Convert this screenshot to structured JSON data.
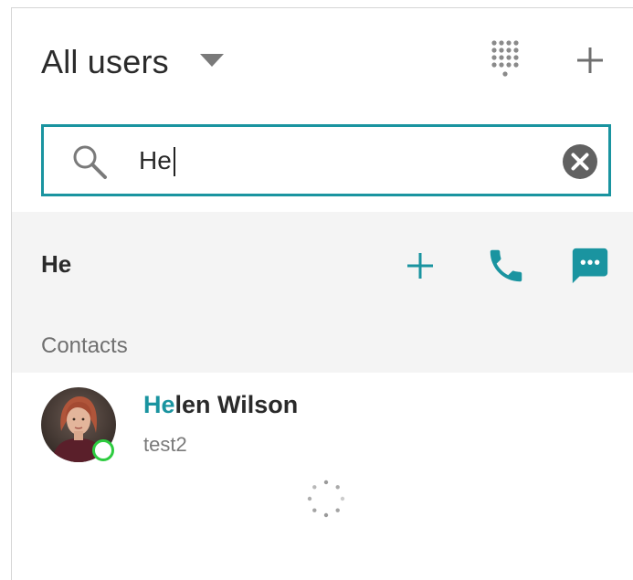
{
  "header": {
    "title": "All users",
    "dropdown_icon": "caret-down-icon",
    "dialpad_icon": "dialpad-icon",
    "add_icon": "plus-icon"
  },
  "search": {
    "value": "He",
    "search_icon": "search-icon",
    "clear_icon": "clear-circle-icon",
    "accent_color": "#1a94a0"
  },
  "suggestion": {
    "term": "He",
    "actions": [
      {
        "icon": "plus-icon"
      },
      {
        "icon": "phone-icon"
      },
      {
        "icon": "chat-icon"
      }
    ]
  },
  "contacts_section": {
    "label": "Contacts"
  },
  "contacts": [
    {
      "name_match": "He",
      "name_rest": "len Wilson",
      "subtitle": "test2",
      "presence": "online",
      "presence_color": "#2ecc40"
    }
  ],
  "loading": {
    "icon": "loading-spinner-icon"
  }
}
